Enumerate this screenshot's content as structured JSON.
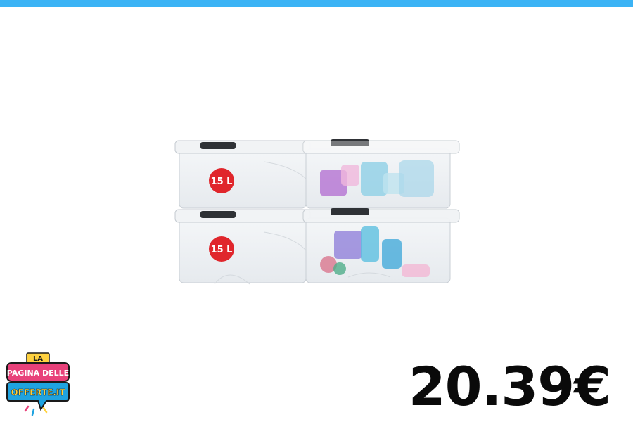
{
  "header": {
    "bar_color": "#3bb3f5"
  },
  "product": {
    "image_name": "storage-boxes-image",
    "capacity_label": "15 L",
    "box_count": 4
  },
  "logo": {
    "line1": "LA",
    "line2": "PAGINA DELLE",
    "line3": "OFFERTE.IT",
    "colors": {
      "pink": "#e8417a",
      "blue": "#1fa3e0",
      "yellow": "#ffd23f",
      "dark": "#1a1a1a"
    }
  },
  "price": {
    "value": "20.39€"
  }
}
